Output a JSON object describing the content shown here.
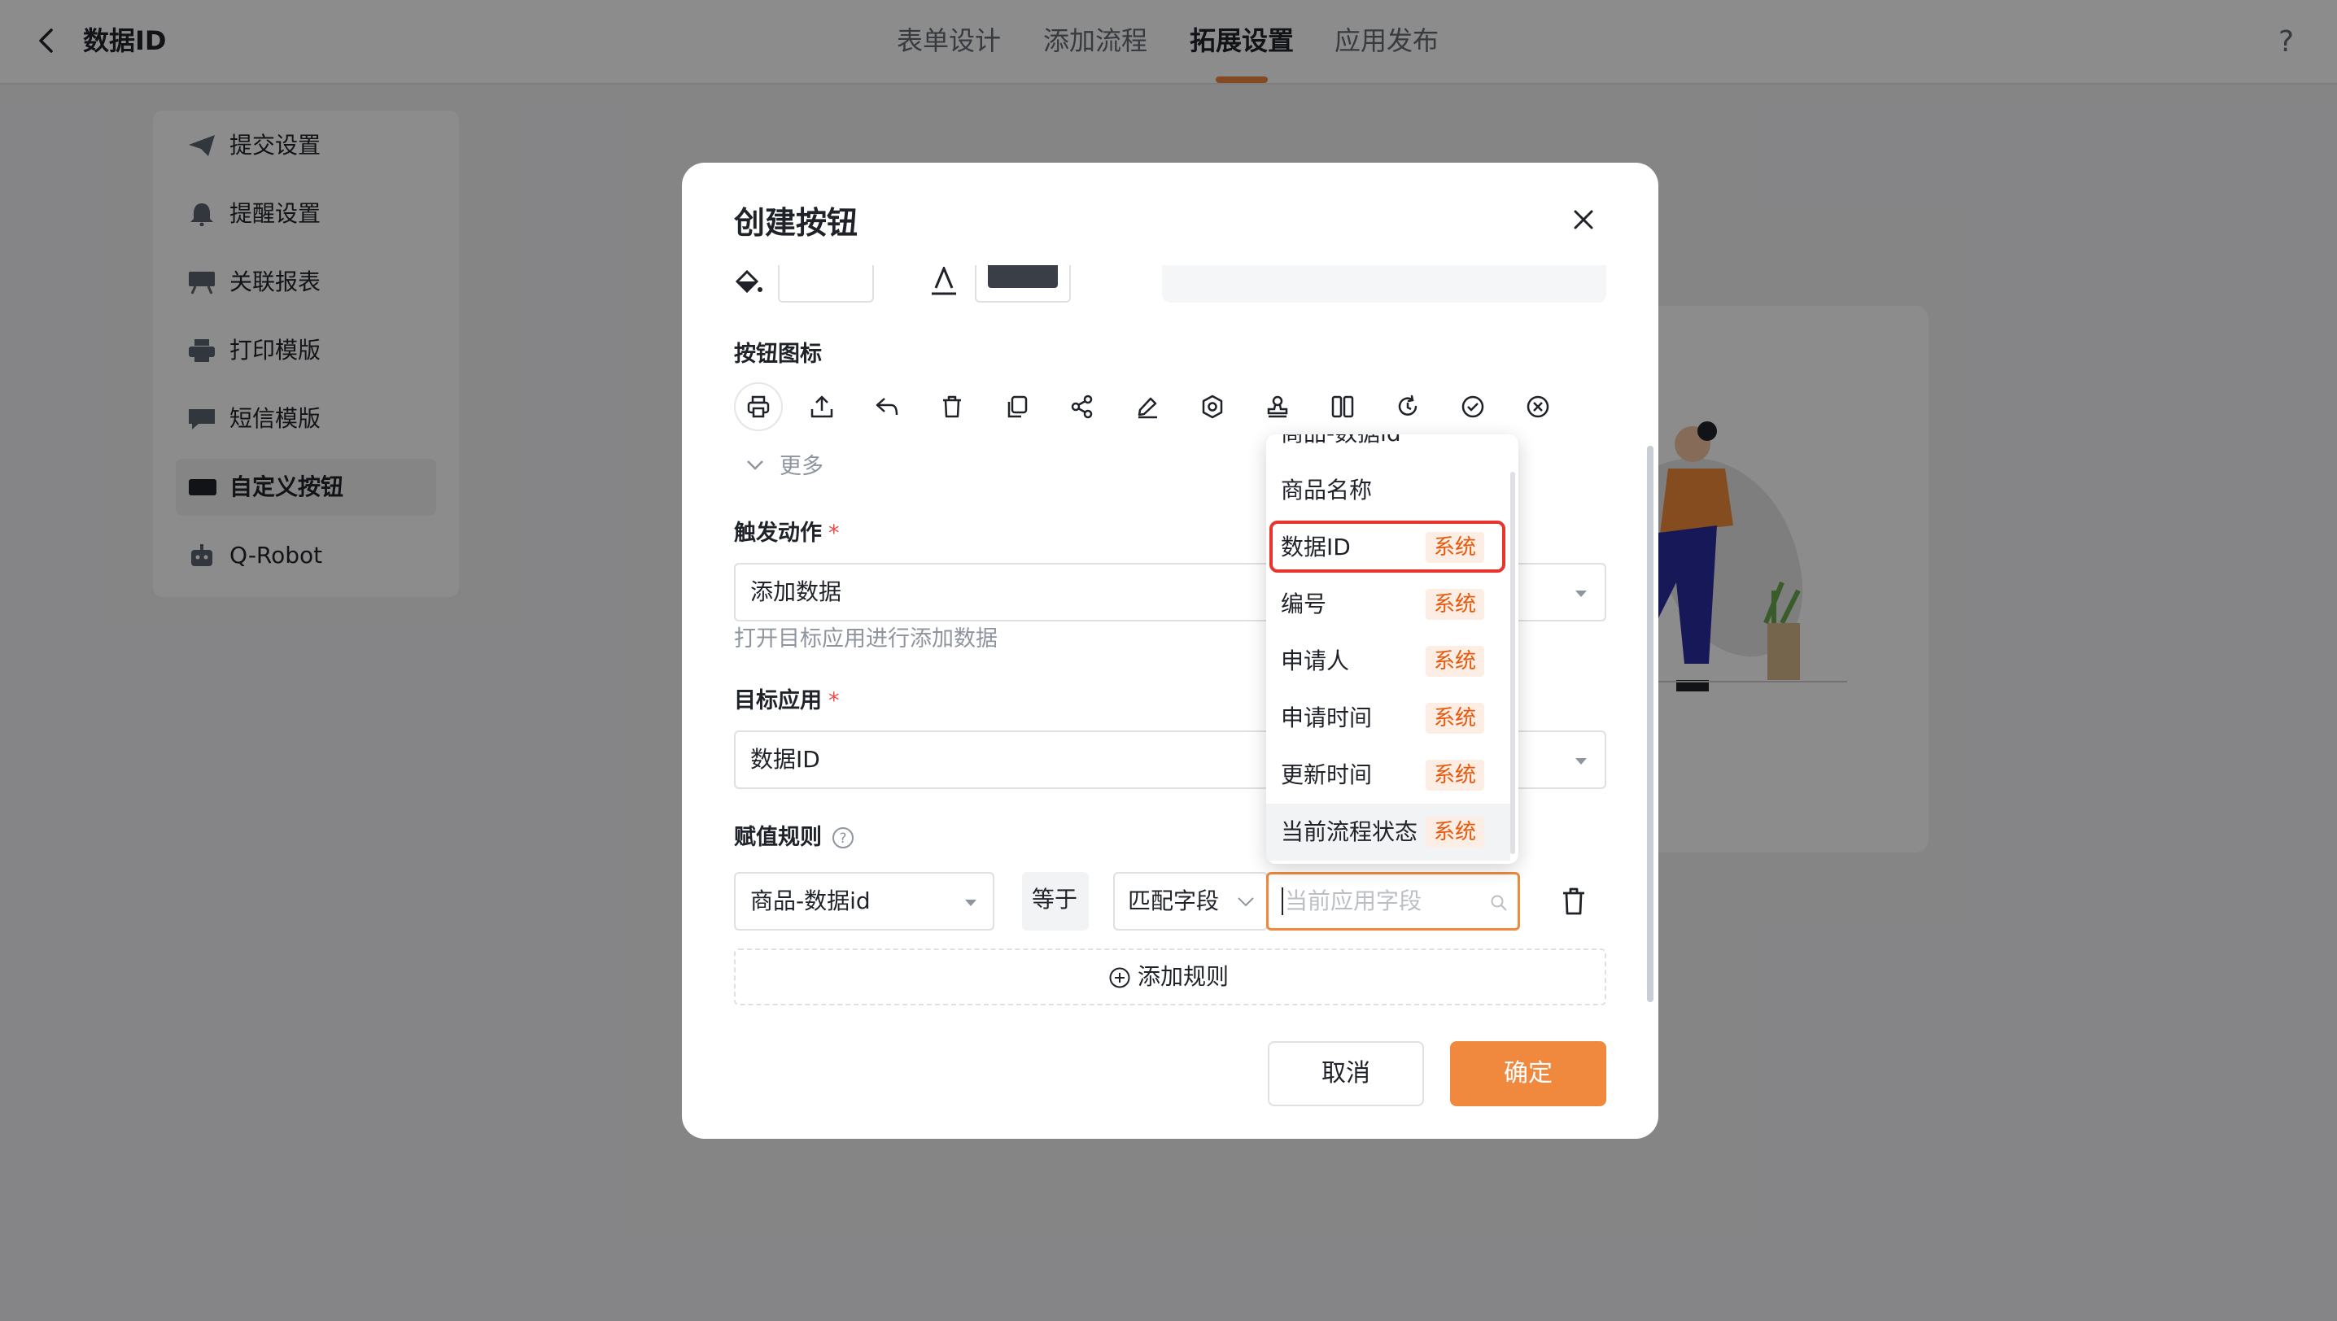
{
  "header": {
    "title": "数据ID",
    "tabs": [
      {
        "label": "表单设计"
      },
      {
        "label": "添加流程"
      },
      {
        "label": "拓展设置"
      },
      {
        "label": "应用发布"
      }
    ],
    "help": "?"
  },
  "sidebar": {
    "items": [
      {
        "label": "提交设置"
      },
      {
        "label": "提醒设置"
      },
      {
        "label": "关联报表"
      },
      {
        "label": "打印模版"
      },
      {
        "label": "短信模版"
      },
      {
        "label": "自定义按钮"
      },
      {
        "label": "Q-Robot"
      }
    ]
  },
  "modal": {
    "title": "创建按钮",
    "icon_section_label": "按钮图标",
    "icons": [
      "printer-icon",
      "upload-icon",
      "reply-icon",
      "trash-icon",
      "copy-icon",
      "share-icon",
      "edit-icon",
      "settings-icon",
      "stamp-icon",
      "columns-icon",
      "refresh-icon",
      "check-circle-icon",
      "close-circle-icon"
    ],
    "more_label": "更多",
    "trigger_label": "触发动作",
    "trigger_value": "添加数据",
    "trigger_hint": "打开目标应用进行添加数据",
    "target_label": "目标应用",
    "target_value": "数据ID",
    "rule_label": "赋值规则",
    "rule_field": "商品-数据id",
    "rule_op": "等于",
    "rule_match": "匹配字段",
    "rule_search_placeholder": "当前应用字段",
    "add_rule_label": "添加规则",
    "cancel_label": "取消",
    "confirm_label": "确定",
    "accent_color": "#f0883e"
  },
  "dropdown": {
    "partial_item": "商品-数据id",
    "items": [
      {
        "label": "商品名称",
        "tag": ""
      },
      {
        "label": "数据ID",
        "tag": "系统"
      },
      {
        "label": "编号",
        "tag": "系统"
      },
      {
        "label": "申请人",
        "tag": "系统"
      },
      {
        "label": "申请时间",
        "tag": "系统"
      },
      {
        "label": "更新时间",
        "tag": "系统"
      },
      {
        "label": "当前流程状态",
        "tag": "系统"
      }
    ]
  }
}
